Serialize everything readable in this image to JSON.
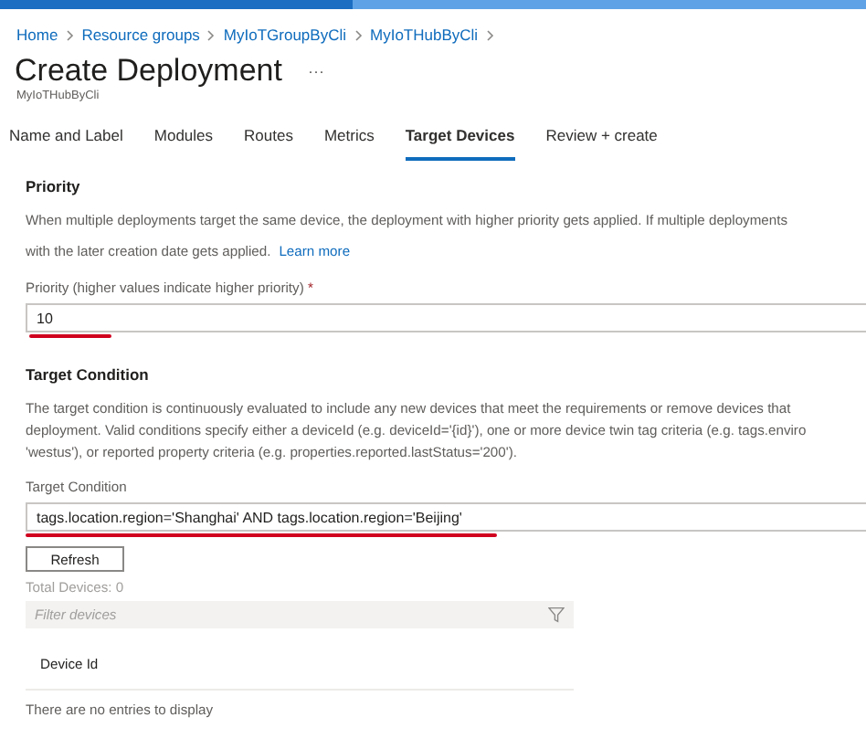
{
  "breadcrumb": [
    "Home",
    "Resource groups",
    "MyIoTGroupByCli",
    "MyIoTHubByCli"
  ],
  "title": "Create Deployment",
  "more": "···",
  "subtitle": "MyIoTHubByCli",
  "tabs": [
    {
      "label": "Name and Label",
      "selected": false
    },
    {
      "label": "Modules",
      "selected": false
    },
    {
      "label": "Routes",
      "selected": false
    },
    {
      "label": "Metrics",
      "selected": false
    },
    {
      "label": "Target Devices",
      "selected": true
    },
    {
      "label": "Review + create",
      "selected": false
    }
  ],
  "priority": {
    "heading": "Priority",
    "description": [
      "When multiple deployments target the same device, the deployment with higher priority gets applied. If multiple deployments",
      "with the later creation date gets applied."
    ],
    "link": "Learn more",
    "label": "Priority (higher values indicate higher priority)",
    "required": "*",
    "value": "10"
  },
  "target_condition": {
    "heading": "Target Condition",
    "description": [
      "The target condition is continuously evaluated to include any new devices that meet the requirements or remove devices that",
      "deployment. Valid conditions specify either a deviceId (e.g. deviceId='{id}'), one or more device twin tag criteria (e.g. tags.enviro",
      "'westus'), or reported property criteria (e.g. properties.reported.lastStatus='200')."
    ],
    "label": "Target Condition",
    "value": "tags.location.region='Shanghai' AND tags.location.region='Beijing'"
  },
  "refresh_button": "Refresh",
  "total_devices": "Total Devices: 0",
  "filter": {
    "placeholder": "Filter devices"
  },
  "table": {
    "columns": [
      "Device Id"
    ],
    "empty_message": "There are no entries to display"
  }
}
